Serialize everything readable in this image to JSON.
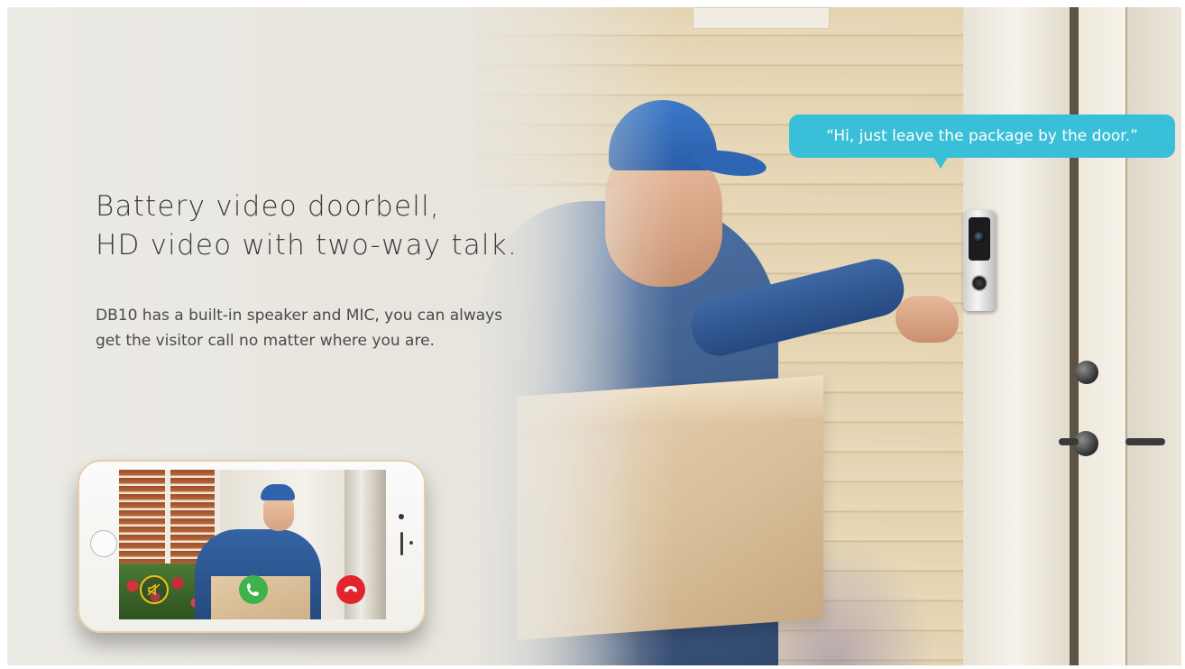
{
  "headline": {
    "line1": "Battery video doorbell,",
    "line2": "HD video with two-way talk."
  },
  "description": "DB10 has a built-in speaker and MIC, you can always get the visitor call no matter where you are.",
  "speech_bubble": "“Hi, just leave the package by the door.”",
  "phone_call": {
    "buttons": [
      {
        "name": "mute",
        "icon": "mute-icon",
        "color": "#f1c40f"
      },
      {
        "name": "accept",
        "icon": "phone-accept-icon",
        "color": "#3fb24b"
      },
      {
        "name": "decline",
        "icon": "phone-decline-icon",
        "color": "#e2242c"
      }
    ]
  },
  "colors": {
    "bubble": "#39bfd7",
    "headline_text": "#3b3b3b",
    "body_text": "#4a4a4a"
  }
}
